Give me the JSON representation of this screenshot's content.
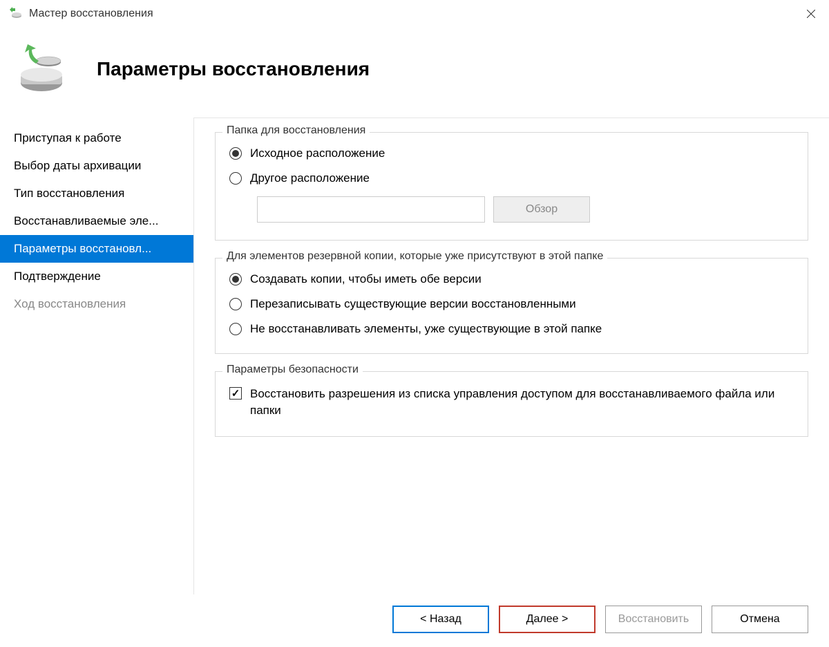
{
  "window": {
    "title": "Мастер восстановления"
  },
  "header": {
    "title": "Параметры восстановления"
  },
  "sidebar": {
    "items": [
      {
        "label": "Приступая к работе",
        "state": "normal"
      },
      {
        "label": "Выбор даты архивации",
        "state": "normal"
      },
      {
        "label": "Тип восстановления",
        "state": "normal"
      },
      {
        "label": "Восстанавливаемые эле...",
        "state": "normal"
      },
      {
        "label": "Параметры восстановл...",
        "state": "active"
      },
      {
        "label": "Подтверждение",
        "state": "normal"
      },
      {
        "label": "Ход восстановления",
        "state": "disabled"
      }
    ]
  },
  "group_folder": {
    "legend": "Папка для восстановления",
    "option_original": "Исходное расположение",
    "option_other": "Другое расположение",
    "path_value": "",
    "browse_label": "Обзор"
  },
  "group_existing": {
    "legend": "Для элементов резервной копии, которые уже присутствуют в этой папке",
    "option_copy": "Создавать копии, чтобы иметь обе версии",
    "option_overwrite": "Перезаписывать существующие версии восстановленными",
    "option_skip": "Не восстанавливать элементы, уже существующие в этой папке"
  },
  "group_security": {
    "legend": "Параметры безопасности",
    "checkbox_acl": "Восстановить разрешения из списка управления доступом для восстанавливаемого файла или папки"
  },
  "footer": {
    "back": "< Назад",
    "next": "Далее >",
    "restore": "Восстановить",
    "cancel": "Отмена"
  }
}
